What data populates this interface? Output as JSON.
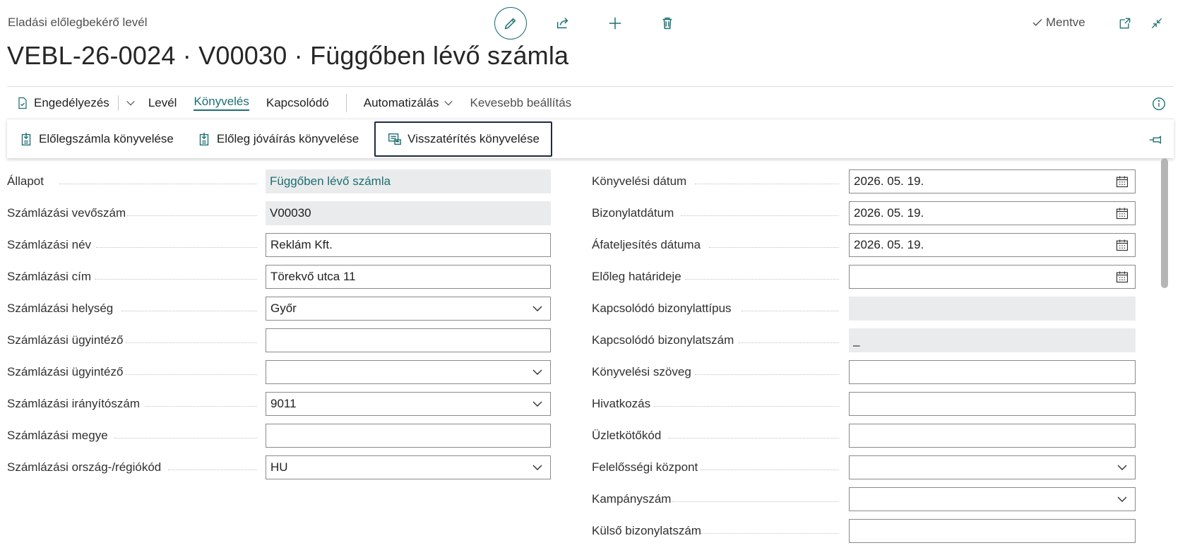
{
  "header": {
    "caption": "Eladási előlegbekérő levél",
    "title": "VEBL-26-0024 · V00030 · Függőben lévő számla",
    "saved_label": "Mentve"
  },
  "actions": {
    "approve": "Engedélyezés",
    "letter": "Levél",
    "posting": "Könyvelés",
    "related": "Kapcsolódó",
    "automate": "Automatizálás",
    "fewer": "Kevesebb beállítás"
  },
  "subactions": {
    "post_invoice": "Előlegszámla könyvelése",
    "post_credit": "Előleg jóváírás könyvelése",
    "post_refund": "Visszatérítés könyvelése"
  },
  "left_fields": [
    {
      "label": "Állapot",
      "value": "Függőben lévő számla"
    },
    {
      "label": "Számlázási vevőszám",
      "value": "V00030"
    },
    {
      "label": "Számlázási név",
      "value": "Reklám Kft."
    },
    {
      "label": "Számlázási cím",
      "value": "Törekvő utca 11"
    },
    {
      "label": "Számlázási helység",
      "value": "Győr"
    },
    {
      "label": "Számlázási ügyintéző",
      "value": ""
    },
    {
      "label": "Számlázási ügyintéző",
      "value": ""
    },
    {
      "label": "Számlázási irányítószám",
      "value": "9011"
    },
    {
      "label": "Számlázási megye",
      "value": ""
    },
    {
      "label": "Számlázási ország-/régiókód",
      "value": "HU"
    }
  ],
  "right_fields": [
    {
      "label": "Könyvelési dátum",
      "value": "2026. 05. 19."
    },
    {
      "label": "Bizonylatdátum",
      "value": "2026. 05. 19."
    },
    {
      "label": "Áfateljesítés dátuma",
      "value": "2026. 05. 19."
    },
    {
      "label": "Előleg határideje",
      "value": ""
    },
    {
      "label": "Kapcsolódó bizonylattípus",
      "value": ""
    },
    {
      "label": "Kapcsolódó bizonylatszám",
      "value": "_"
    },
    {
      "label": "Könyvelési szöveg",
      "value": ""
    },
    {
      "label": "Hivatkozás",
      "value": ""
    },
    {
      "label": "Üzletkötőkód",
      "value": ""
    },
    {
      "label": "Felelősségi központ",
      "value": ""
    },
    {
      "label": "Kampányszám",
      "value": ""
    },
    {
      "label": "Külső bizonylatszám",
      "value": ""
    }
  ],
  "colors": {
    "accent": "#1b6f72",
    "focus": "#1e2a40",
    "readonly": "#eaebec"
  }
}
